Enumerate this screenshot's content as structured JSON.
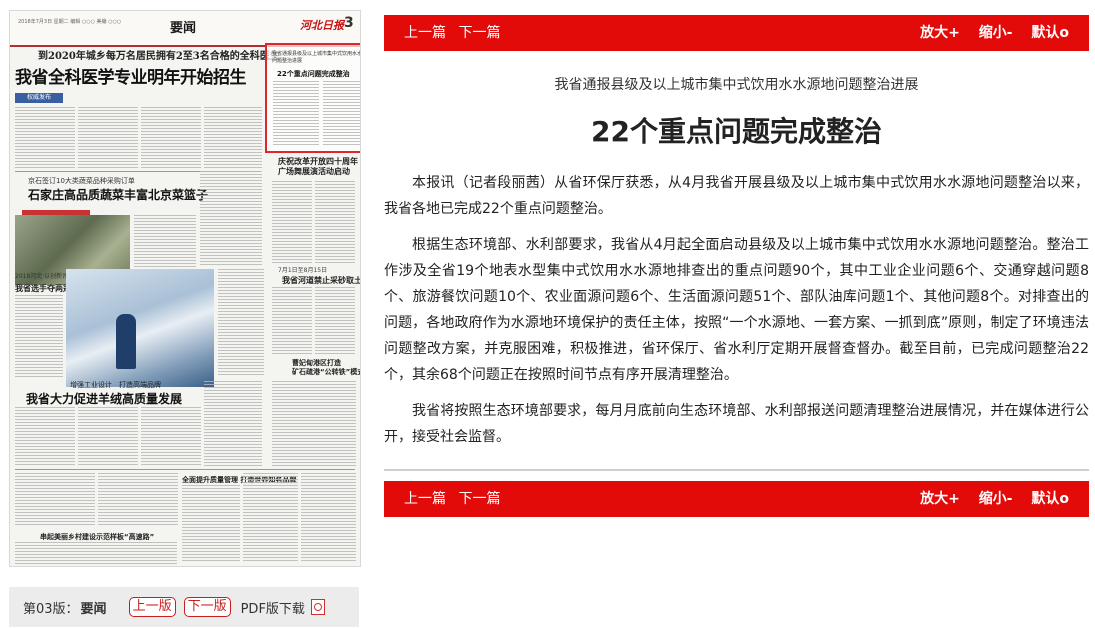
{
  "newspaper": {
    "masthead_small": "2018年7月3日 星期二\n编辑 ○○○ 美编 ○○○",
    "section": "要闻",
    "logo": "河北日报",
    "page_number": "3",
    "kicker": "到2020年城乡每万名居民拥有2至3名合格的全科医生",
    "headline": "我省全科医学专业明年开始招生",
    "tag": "权威发布",
    "story2_sub": "京石签订10大类蔬菜品种采购订单",
    "story2_title": "石家庄高品质蔬菜丰富北京菜篮子",
    "story3_sub": "2018河北·以创新评价推进",
    "story3_title": "我省选手夺两冠军",
    "story4_sub": "增强工业设计　打造高端品牌",
    "story4_title": "我省大力促进羊绒高质量发展",
    "right_h1": "庆祝改革开放四十周年\n广场舞展演活动启动",
    "right_h2_sub": "7月1日至8月15日",
    "right_h2": "我省河道禁止采砂取土",
    "right_h3": "曹妃甸港区打造\n矿石疏港“公转铁”模式",
    "story5_title": "全面提升质量管理 打造世界知名品牌",
    "story6_title": "串起美丽乡村建设示范样板“高速路”",
    "hotspot_kicker": "我省通报县级及以上城市集中式饮用水水源地问题整治进展",
    "hotspot_title": "22个重点问题完成整治"
  },
  "page_nav": {
    "edition_label": "第03版：",
    "edition_name": "要闻",
    "prev": "上一版",
    "next": "下一版",
    "pdf": "PDF版下载"
  },
  "toolbar": {
    "prev": "上一篇",
    "next": "下一篇",
    "zoom_in": "放大+",
    "zoom_out": "缩小-",
    "reset": "默认o"
  },
  "article": {
    "subtitle": "我省通报县级及以上城市集中式饮用水水源地问题整治进展",
    "title": "22个重点问题完成整治",
    "paragraphs": [
      "本报讯（记者段丽茜）从省环保厅获悉，从4月我省开展县级及以上城市集中式饮用水水源地问题整治以来，我省各地已完成22个重点问题整治。",
      "根据生态环境部、水利部要求，我省从4月起全面启动县级及以上城市集中式饮用水水源地问题整治。整治工作涉及全省19个地表水型集中式饮用水水源地排查出的重点问题90个，其中工业企业问题6个、交通穿越问题8个、旅游餐饮问题10个、农业面源问题6个、生活面源问题51个、部队油库问题1个、其他问题8个。对排查出的问题，各地政府作为水源地环境保护的责任主体，按照“一个水源地、一套方案、一抓到底”原则，制定了环境违法问题整改方案，并克服困难，积极推进，省环保厅、省水利厅定期开展督查督办。截至目前，已完成问题整治22个，其余68个问题正在按照时间节点有序开展清理整治。",
      "我省将按照生态环境部要求，每月月底前向生态环境部、水利部报送问题清理整治进展情况，并在媒体进行公开，接受社会监督。"
    ]
  }
}
